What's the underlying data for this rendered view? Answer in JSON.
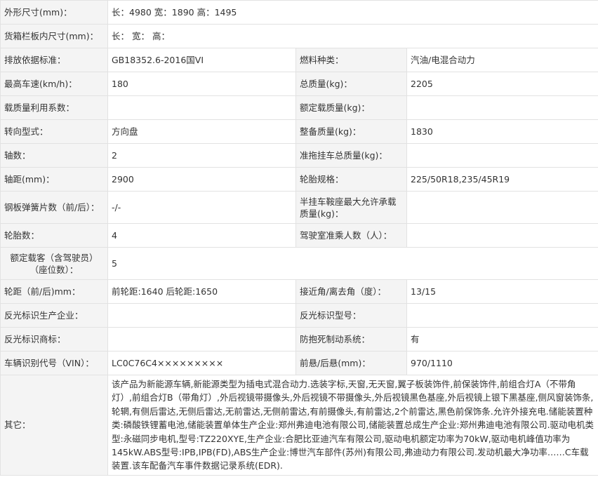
{
  "rows": [
    {
      "type": "wide",
      "label": "外形尺寸(mm)：",
      "value": "长：4980 宽：1890 高：1495"
    },
    {
      "type": "wide",
      "label": "货箱栏板内尺寸(mm)：",
      "value": "长：  宽：  高："
    },
    {
      "type": "pair",
      "label1": "排放依据标准：",
      "value1": "GB18352.6-2016国VI",
      "label2": "燃料种类：",
      "value2": "汽油/电混合动力"
    },
    {
      "type": "pair",
      "label1": "最高车速(km/h)：",
      "value1": "180",
      "label2": "总质量(kg)：",
      "value2": "2205"
    },
    {
      "type": "pair",
      "label1": "载质量利用系数：",
      "value1": "",
      "label2": "额定载质量(kg)：",
      "value2": ""
    },
    {
      "type": "pair",
      "label1": "转向型式：",
      "value1": "方向盘",
      "label2": "整备质量(kg)：",
      "value2": "1830"
    },
    {
      "type": "pair",
      "label1": "轴数：",
      "value1": "2",
      "label2": "准拖挂车总质量(kg)：",
      "value2": ""
    },
    {
      "type": "pair",
      "label1": "轴距(mm)：",
      "value1": "2900",
      "label2": "轮胎规格：",
      "value2": "225/50R18,235/45R19"
    },
    {
      "type": "pair",
      "label1": "钢板弹簧片数（前/后）：",
      "value1": "-/-",
      "label2": "半挂车鞍座最大允许承载质量(kg)：",
      "value2": ""
    },
    {
      "type": "pair",
      "label1": "轮胎数：",
      "value1": "4",
      "label2": "驾驶室准乘人数（人）：",
      "value2": ""
    },
    {
      "type": "wide",
      "label": "额定载客（含驾驶员）（座位数）：",
      "value": "5"
    },
    {
      "type": "pair",
      "label1": "轮距（前/后)mm：",
      "value1": "前轮距:1640 后轮距:1650",
      "label2": "接近角/离去角（度）：",
      "value2": "13/15"
    },
    {
      "type": "pair",
      "label1": "反光标识生产企业：",
      "value1": "",
      "label2": "反光标识型号：",
      "value2": ""
    },
    {
      "type": "pair",
      "label1": "反光标识商标：",
      "value1": "",
      "label2": "防抱死制动系统：",
      "value2": "有"
    },
    {
      "type": "pair",
      "label1": "车辆识别代号（VIN）：",
      "value1": "LC0C76C4×××××××××",
      "label2": "前悬/后悬(mm)：",
      "value2": "970/1110"
    },
    {
      "type": "note",
      "label": "其它：",
      "value": "该产品为新能源车辆,新能源类型为插电式混合动力.选装字标,天窗,无天窗,翼子板装饰件,前保装饰件,前组合灯A（不带角灯）,前组合灯B（带角灯）,外后视镜带摄像头,外后视镜不带摄像头,外后视镜黑色基座,外后视镜上银下黑基座,侧风窗装饰条,轮辋,有侧后雷达,无侧后雷达,无前雷达,无侧前雷达,有前摄像头,有前雷达,2个前雷达,黑色前保饰条.允许外接充电.储能装置种类:磷酸铁锂蓄电池,储能装置单体生产企业:郑州弗迪电池有限公司,储能装置总成生产企业:郑州弗迪电池有限公司.驱动电机类型:永磁同步电机,型号:TZ220XYE,生产企业:合肥比亚迪汽车有限公司,驱动电机额定功率为70kW,驱动电机峰值功率为145kW.ABS型号:IPB,IPB(FD),ABS生产企业:博世汽车部件(苏州)有限公司,弗迪动力有限公司.发动机最大净功率……C车载装置.该车配备汽车事件数据记录系统(EDR)."
    }
  ]
}
